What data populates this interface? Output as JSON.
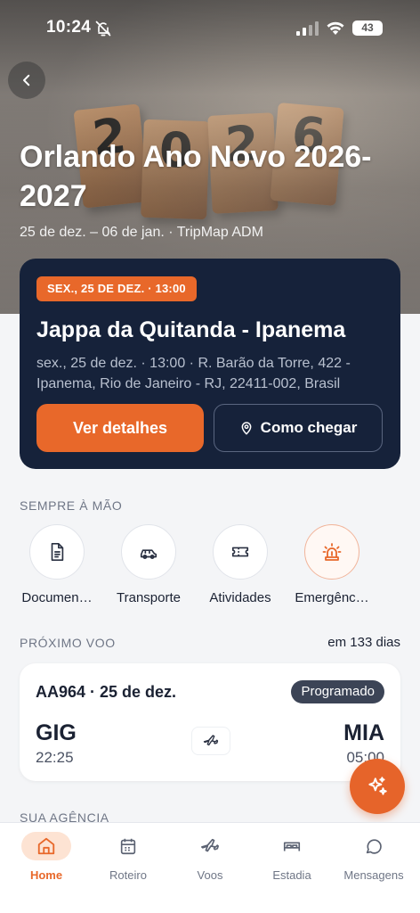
{
  "status_bar": {
    "time": "10:24",
    "battery": "43"
  },
  "hero": {
    "digits": [
      "2",
      "0",
      "2",
      "6"
    ],
    "title": "Orlando Ano Novo 2026-2027",
    "subtitle": "25 de dez. – 06 de jan. · TripMap ADM"
  },
  "event": {
    "badge": "SEX., 25 DE DEZ. · 13:00",
    "name": "Jappa da Quitanda - Ipanema",
    "description": "sex., 25 de dez. · 13:00 · R. Barão da Torre, 422 - Ipanema, Rio de Janeiro - RJ, 22411-002, Brasil",
    "details_label": "Ver detalhes",
    "directions_label": "Como chegar"
  },
  "quick_access": {
    "title": "SEMPRE À MÃO",
    "items": [
      {
        "label": "Documen…",
        "icon": "document-icon"
      },
      {
        "label": "Transporte",
        "icon": "car-icon"
      },
      {
        "label": "Atividades",
        "icon": "ticket-icon"
      },
      {
        "label": "Emergênc…",
        "icon": "siren-icon"
      }
    ]
  },
  "flight": {
    "section_title": "PRÓXIMO VOO",
    "countdown": "em 133 dias",
    "header": "AA964 · 25 de dez.",
    "status": "Programado",
    "from_code": "GIG",
    "from_time": "22:25",
    "to_code": "MIA",
    "to_time": "05:00"
  },
  "agency": {
    "section_title": "SUA AGÊNCIA"
  },
  "nav": {
    "items": [
      {
        "label": "Home",
        "icon": "home-icon"
      },
      {
        "label": "Roteiro",
        "icon": "calendar-icon"
      },
      {
        "label": "Voos",
        "icon": "plane-icon"
      },
      {
        "label": "Estadia",
        "icon": "bed-icon"
      },
      {
        "label": "Mensagens",
        "icon": "chat-icon"
      }
    ]
  },
  "colors": {
    "accent": "#e8682a",
    "card_dark": "#16223a",
    "background": "#f4f5f7"
  }
}
